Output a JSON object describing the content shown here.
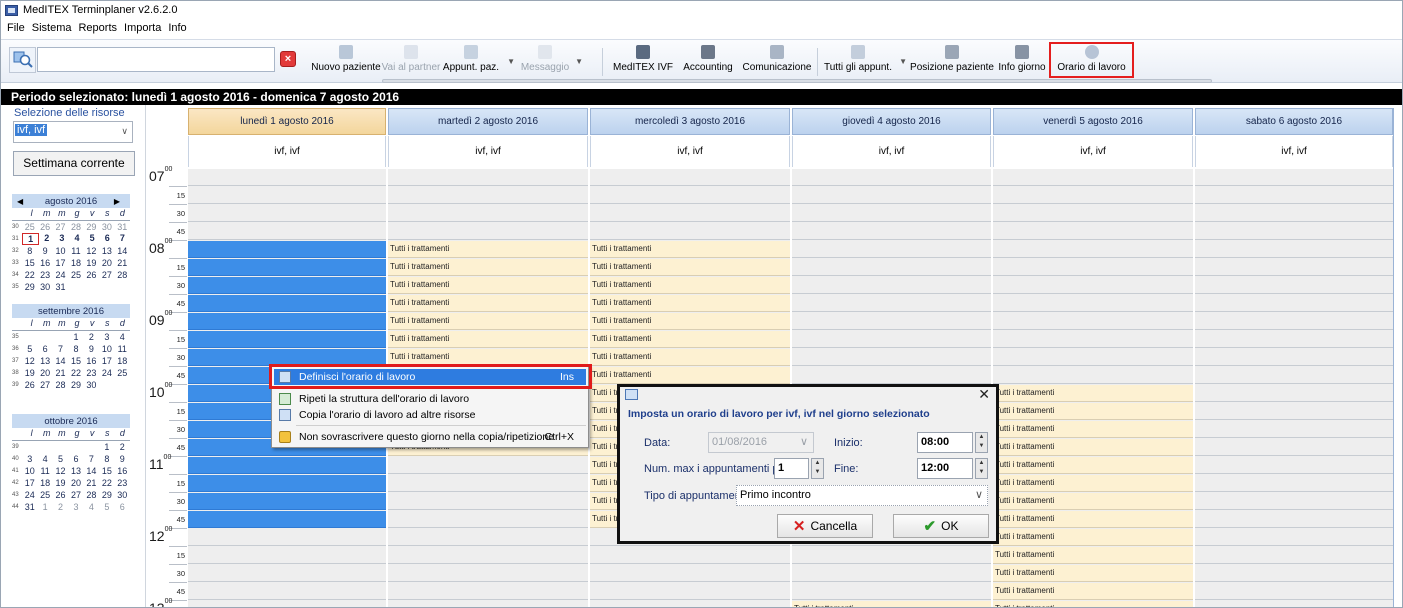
{
  "window": {
    "title": "MedITEX Terminplaner v2.6.2.0"
  },
  "menu": [
    "File",
    "Sistema",
    "Reports",
    "Importa",
    "Info"
  ],
  "toolbar": {
    "search_value": "",
    "buttons": [
      {
        "label": "Nuovo paziente",
        "enabled": true
      },
      {
        "label": "Vai al partner",
        "enabled": false
      },
      {
        "label": "Appunt. paz.",
        "enabled": true
      },
      {
        "label": "Messaggio",
        "enabled": false
      },
      {
        "label": "MedITEX IVF",
        "enabled": true
      },
      {
        "label": "Accounting",
        "enabled": true
      },
      {
        "label": "Comunicazione",
        "enabled": true
      },
      {
        "label": "Tutti gli appunt.",
        "enabled": true
      },
      {
        "label": "Posizione paziente",
        "enabled": true
      },
      {
        "label": "Info giorno",
        "enabled": true
      },
      {
        "label": "Orario di lavoro",
        "enabled": true,
        "highlighted": true
      }
    ]
  },
  "period": {
    "text": "Periodo selezionato:  lunedì 1 agosto 2016 - domenica 7 agosto 2016"
  },
  "left_panel": {
    "resource_label": "Selezione delle risorse",
    "resource_value": "ivf, ivf",
    "week_button": "Settimana corrente",
    "calendars": [
      {
        "month": "agosto 2016",
        "dow": [
          "l",
          "m",
          "m",
          "g",
          "v",
          "s",
          "d"
        ],
        "rows": [
          {
            "wk": "30",
            "days": [
              "25",
              "26",
              "27",
              "28",
              "29",
              "30",
              "31"
            ],
            "grey": true
          },
          {
            "wk": "31",
            "days": [
              "1",
              "2",
              "3",
              "4",
              "5",
              "6",
              "7"
            ],
            "selected": true
          },
          {
            "wk": "32",
            "days": [
              "8",
              "9",
              "10",
              "11",
              "12",
              "13",
              "14"
            ]
          },
          {
            "wk": "33",
            "days": [
              "15",
              "16",
              "17",
              "18",
              "19",
              "20",
              "21"
            ]
          },
          {
            "wk": "34",
            "days": [
              "22",
              "23",
              "24",
              "25",
              "26",
              "27",
              "28"
            ]
          },
          {
            "wk": "35",
            "days": [
              "29",
              "30",
              "31",
              "",
              "",
              "",
              ""
            ]
          }
        ]
      },
      {
        "month": "settembre 2016",
        "dow": [
          "l",
          "m",
          "m",
          "g",
          "v",
          "s",
          "d"
        ],
        "rows": [
          {
            "wk": "35",
            "days": [
              "",
              "",
              "",
              "1",
              "2",
              "3",
              "4"
            ]
          },
          {
            "wk": "36",
            "days": [
              "5",
              "6",
              "7",
              "8",
              "9",
              "10",
              "11"
            ]
          },
          {
            "wk": "37",
            "days": [
              "12",
              "13",
              "14",
              "15",
              "16",
              "17",
              "18"
            ]
          },
          {
            "wk": "38",
            "days": [
              "19",
              "20",
              "21",
              "22",
              "23",
              "24",
              "25"
            ]
          },
          {
            "wk": "39",
            "days": [
              "26",
              "27",
              "28",
              "29",
              "30",
              "",
              ""
            ]
          }
        ]
      },
      {
        "month": "ottobre 2016",
        "dow": [
          "l",
          "m",
          "m",
          "g",
          "v",
          "s",
          "d"
        ],
        "rows": [
          {
            "wk": "39",
            "days": [
              "",
              "",
              "",
              "",
              "",
              "1",
              "2"
            ]
          },
          {
            "wk": "40",
            "days": [
              "3",
              "4",
              "5",
              "6",
              "7",
              "8",
              "9"
            ]
          },
          {
            "wk": "41",
            "days": [
              "10",
              "11",
              "12",
              "13",
              "14",
              "15",
              "16"
            ]
          },
          {
            "wk": "42",
            "days": [
              "17",
              "18",
              "19",
              "20",
              "21",
              "22",
              "23"
            ]
          },
          {
            "wk": "43",
            "days": [
              "24",
              "25",
              "26",
              "27",
              "28",
              "29",
              "30"
            ]
          },
          {
            "wk": "44",
            "days": [
              "31",
              "1",
              "2",
              "3",
              "4",
              "5",
              "6"
            ],
            "grey_after": 1
          }
        ]
      }
    ]
  },
  "time_axis": {
    "hours": [
      "07",
      "08",
      "09",
      "10",
      "11",
      "12",
      "13"
    ],
    "hour_suffix": "00",
    "quarters": [
      "15",
      "30",
      "45"
    ]
  },
  "days": [
    {
      "header": "lunedì 1 agosto 2016",
      "resources": "ivf, ivf",
      "today": true
    },
    {
      "header": "martedì 2 agosto 2016",
      "resources": "ivf, ivf"
    },
    {
      "header": "mercoledì 3 agosto 2016",
      "resources": "ivf, ivf"
    },
    {
      "header": "giovedì 4 agosto 2016",
      "resources": "ivf, ivf"
    },
    {
      "header": "venerdì 5 agosto 2016",
      "resources": "ivf, ivf"
    },
    {
      "header": "sabato 6 agosto 2016",
      "resources": "ivf, ivf"
    }
  ],
  "slot_label": "Tutti i trattamenti",
  "context_menu": {
    "items": [
      {
        "label": "Definisci l'orario di lavoro",
        "shortcut": "Ins",
        "active": true
      },
      {
        "label": "Ripeti la struttura dell'orario di lavoro",
        "shortcut": ""
      },
      {
        "label": "Copia l'orario di lavoro ad altre risorse",
        "shortcut": ""
      },
      {
        "label": "Non sovrascrivere questo giorno nella copia/ripetizione",
        "shortcut": "Ctrl+X"
      }
    ]
  },
  "dialog": {
    "title": "Imposta un orario di lavoro per ivf, ivf nel giorno selezionato",
    "data_label": "Data:",
    "data_value": "01/08/2016",
    "inizio_label": "Inizio:",
    "inizio_value": "08:00",
    "max_label": "Num. max i appuntamenti p",
    "max_value": "1",
    "fine_label": "Fine:",
    "fine_value": "12:00",
    "tipo_label": "Tipo di appuntamer",
    "tipo_value": "Primo incontro",
    "cancel_label": "Cancella",
    "ok_label": "OK"
  },
  "colors": {
    "accent_highlight": "#e41e1e",
    "working_slot": "#fdf1d2",
    "selected_block": "#3d8ee8",
    "header_blue": "#bcd2ee",
    "today_header": "#f3d69c"
  }
}
